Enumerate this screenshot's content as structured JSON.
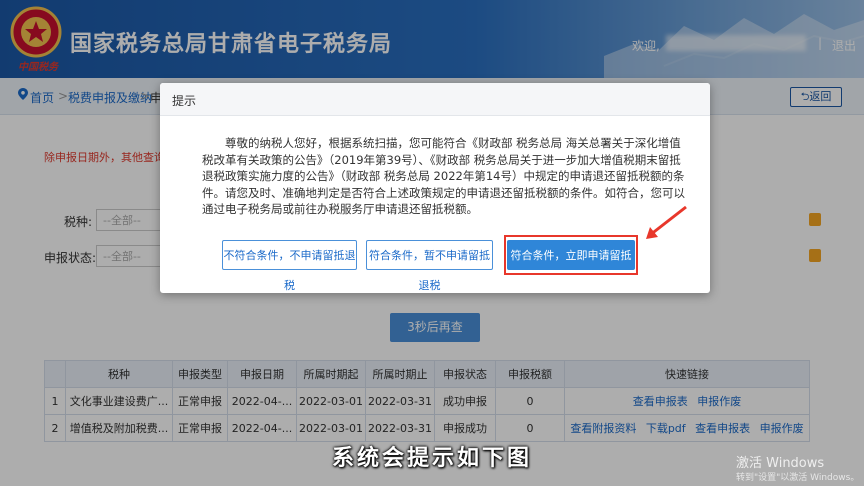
{
  "header": {
    "site_title": "国家税务总局甘肃省电子税务局",
    "slogan": "中国税务",
    "welcome": "欢迎,",
    "separator": "|",
    "logout": "退出"
  },
  "breadcrumb": {
    "home": "首页",
    "sep": ">",
    "item": "税费申报及缴纳",
    "current": "申",
    "back": "返回"
  },
  "page": {
    "notice": "除申报日期外，其他查询条",
    "tax_type_label": "税种:",
    "tax_type_placeholder": "--全部--",
    "status_label": "申报状态:",
    "status_placeholder": "--全部--",
    "requery_button": "3秒后再查"
  },
  "table": {
    "headers": [
      "",
      "税种",
      "申报类型",
      "申报日期",
      "所属时期起",
      "所属时期止",
      "申报状态",
      "申报税额",
      "快速链接"
    ],
    "rows": [
      {
        "idx": "1",
        "tax": "文化事业建设费广...",
        "type": "正常申报",
        "date": "2022-04-...",
        "start": "2022-03-01",
        "end": "2022-03-31",
        "status": "成功申报",
        "amount": "0",
        "links": [
          "查看申报表",
          "申报作废"
        ]
      },
      {
        "idx": "2",
        "tax": "增值税及附加税费...",
        "type": "正常申报",
        "date": "2022-04-...",
        "start": "2022-03-01",
        "end": "2022-03-31",
        "status": "申报成功",
        "amount": "0",
        "links": [
          "查看附报资料",
          "下载pdf",
          "查看申报表",
          "申报作废"
        ]
      }
    ]
  },
  "dialog": {
    "title": "提示",
    "message": "尊敬的纳税人您好，根据系统扫描，您可能符合《财政部 税务总局 海关总署关于深化增值税改革有关政策的公告》（2019年第39号）、《财政部 税务总局关于进一步加大增值税期末留抵退税政策实施力度的公告》（财政部 税务总局 2022年第14号）中规定的申请退还留抵税额的条件。请您及时、准确地判定是否符合上述政策规定的申请退还留抵税额的条件。如符合，您可以通过电子税务局或前往办税服务厅申请退还留抵税额。",
    "btn_not_eligible": "不符合条件，不申请留抵退税",
    "btn_eligible_later": "符合条件，暂不申请留抵退税",
    "btn_eligible_apply": "符合条件，立即申请留抵退税"
  },
  "caption": "系统会提示如下图",
  "watermark": {
    "line1": "激活 Windows",
    "line2": "转到\"设置\"以激活 Windows。"
  },
  "colors": {
    "header_blue": "#1b58a6",
    "link_blue": "#1b6ac9",
    "primary_button": "#2f86d8",
    "highlight_red": "#e8372b",
    "notice_red": "#e03a2e"
  }
}
